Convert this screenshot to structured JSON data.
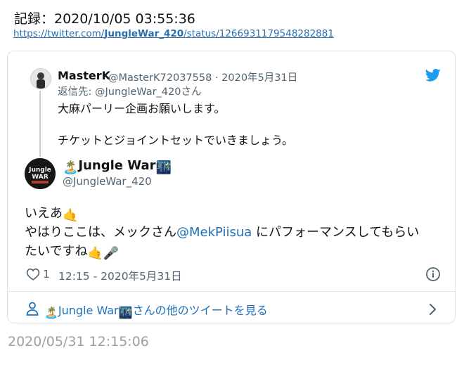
{
  "record": {
    "title": "記録：2020/10/05 03:55:36",
    "url_prefix": "https://twitter.com/",
    "url_user": "JungleWar_420",
    "url_suffix": "/status/1266931179548282881"
  },
  "reply": {
    "name": "MasterK",
    "meta": "@MasterK72037558 · 2020年5月31日",
    "reply_to": "返信先: @JungleWar_420さん",
    "text_line1": "大麻パーリー企画お願いします。",
    "text_line2": "チケットとジョイントセットでいきましょう。"
  },
  "tweet": {
    "name_emoji_left": "🏝️",
    "name": "Jungle War",
    "name_emoji_right": "🌃",
    "handle": "@JungleWar_420",
    "line1_text": "いえあ",
    "line1_emoji": "🤙",
    "line2_text": "やはりここは、メックさん",
    "line2_mention": "@MekPiisua",
    "line2_rest": " にパフォーマンスしてもらい",
    "line3_text": "たいですね",
    "line3_emoji1": "🤙",
    "line3_emoji2": "🎤",
    "like_count": "1",
    "timestamp": "12:15 - 2020年5月31日"
  },
  "more": {
    "emoji_left": "🏝️",
    "name": "Jungle War",
    "emoji_right": "🌃",
    "suffix": "さんの他のツイートを見る"
  },
  "archive": {
    "time": "2020/05/31 12:15:06"
  },
  "colors": {
    "link": "#1d6fb8",
    "twitter_blue": "#1d9bf0",
    "muted": "#536471",
    "border": "#dbe1e6"
  }
}
